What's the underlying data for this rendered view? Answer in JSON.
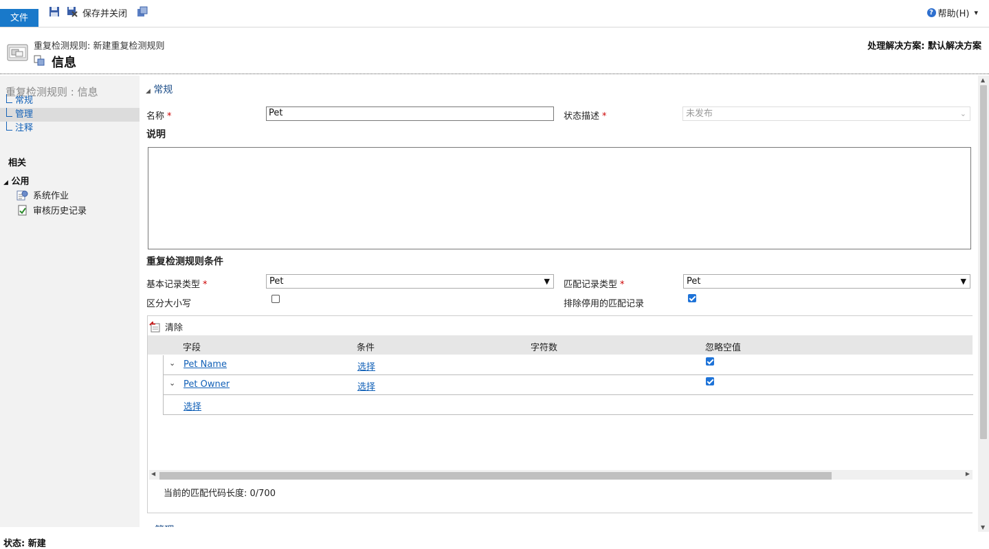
{
  "ribbon": {
    "file_tab": "文件",
    "save_close": "保存并关闭",
    "help": "帮助(H)",
    "help_dropdown": "▾"
  },
  "header": {
    "breadcrumb": "重复检测规则: 新建重复检测规则",
    "title": "信息",
    "solution": "处理解决方案: 默认解决方案"
  },
  "nav": {
    "title": "重复检测规则 : 信息",
    "items": [
      {
        "label": "常规"
      },
      {
        "label": "管理"
      },
      {
        "label": "注释"
      }
    ],
    "related_heading": "相关",
    "common_heading": "公用",
    "related_items": [
      {
        "label": "系统作业",
        "icon": "system-jobs-icon"
      },
      {
        "label": "审核历史记录",
        "icon": "audit-history-icon"
      }
    ]
  },
  "general_section": {
    "header": "常规",
    "name_label": "名称",
    "name_value": "Pet",
    "status_label": "状态描述",
    "status_value": "未发布",
    "description_label": "说明",
    "description_value": ""
  },
  "conditions": {
    "header": "重复检测规则条件",
    "base_type_label": "基本记录类型",
    "base_type_value": "Pet",
    "match_type_label": "匹配记录类型",
    "match_type_value": "Pet",
    "case_label": "区分大小写",
    "case_checked": false,
    "exclude_label": "排除停用的匹配记录",
    "exclude_checked": true
  },
  "grid": {
    "clear_label": "清除",
    "columns": [
      "字段",
      "条件",
      "字符数",
      "忽略空值"
    ],
    "rows": [
      {
        "field": "Pet Name",
        "condition": "选择",
        "chars": "",
        "ignore_blank": true
      },
      {
        "field": "Pet Owner",
        "condition": "选择",
        "chars": "",
        "ignore_blank": true
      }
    ],
    "add_row_link": "选择",
    "match_code_length": "当前的匹配代码长度: 0/700"
  },
  "next_section_header": "管理",
  "status_bar": "状态: 新建",
  "colors": {
    "accent": "#1979ca",
    "link": "#1160b7",
    "required": "#cc0000",
    "nav_background": "#f2f2f2"
  }
}
